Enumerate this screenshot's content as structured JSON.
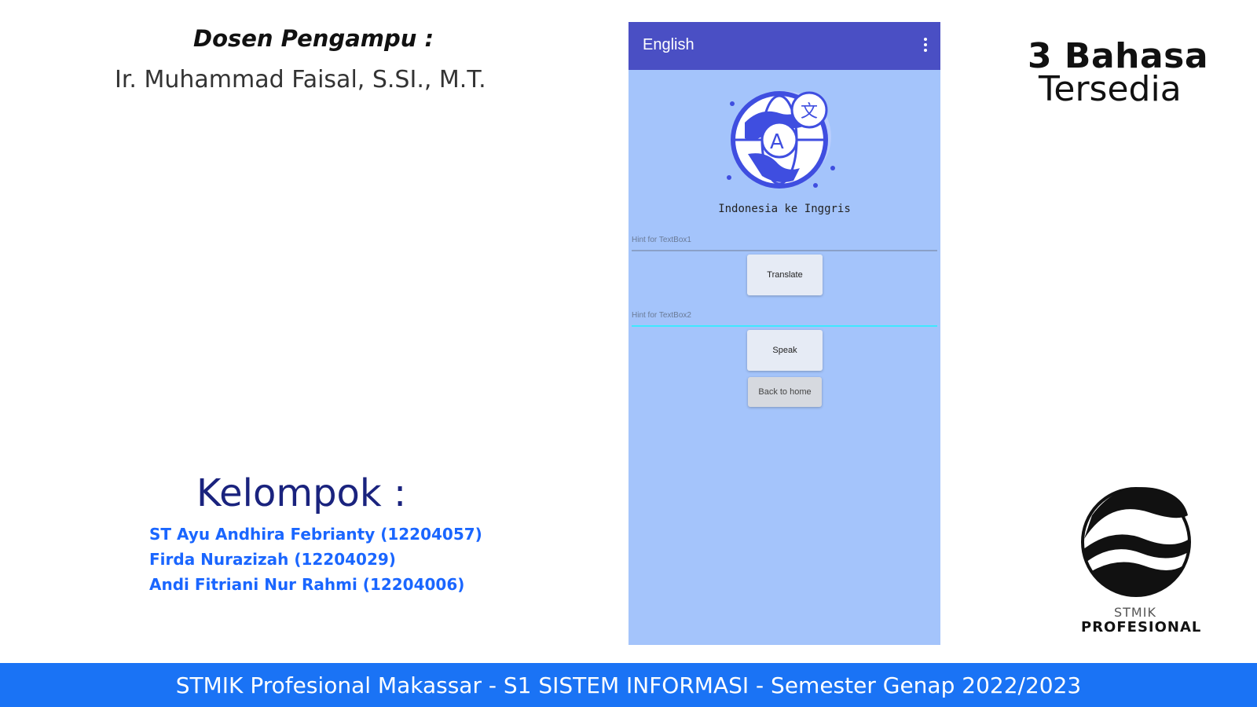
{
  "lecturer": {
    "heading": "Dosen Pengampu :",
    "name": "Ir. Muhammad Faisal, S.SI., M.T."
  },
  "group": {
    "heading": "Kelompok :",
    "members": [
      "ST Ayu Andhira Febrianty (12204057)",
      "Firda Nurazizah (12204029)",
      "Andi Fitriani Nur Rahmi (12204006)"
    ]
  },
  "badge": {
    "line1": "3 Bahasa",
    "line2": "Tersedia"
  },
  "logo": {
    "line1": "STMIK",
    "line2": "PROFESIONAL"
  },
  "phone": {
    "app_title": "English",
    "menu_icon": "overflow-menu-icon",
    "illustration_icon": "globe-translate-icon",
    "subtitle": "Indonesia ke Inggris",
    "textbox1_hint": "Hint for TextBox1",
    "translate_label": "Translate",
    "textbox2_hint": "Hint for TextBox2",
    "speak_label": "Speak",
    "home_label": "Back to home"
  },
  "footer": {
    "text": "STMIK Profesional Makassar - S1 SISTEM INFORMASI - Semester Genap 2022/2023"
  },
  "colors": {
    "app_bar": "#4a4fc4",
    "phone_bg": "#a4c4fb",
    "footer_bg": "#1a73f5",
    "member_text": "#1a66ff",
    "group_heading": "#1a237e"
  }
}
